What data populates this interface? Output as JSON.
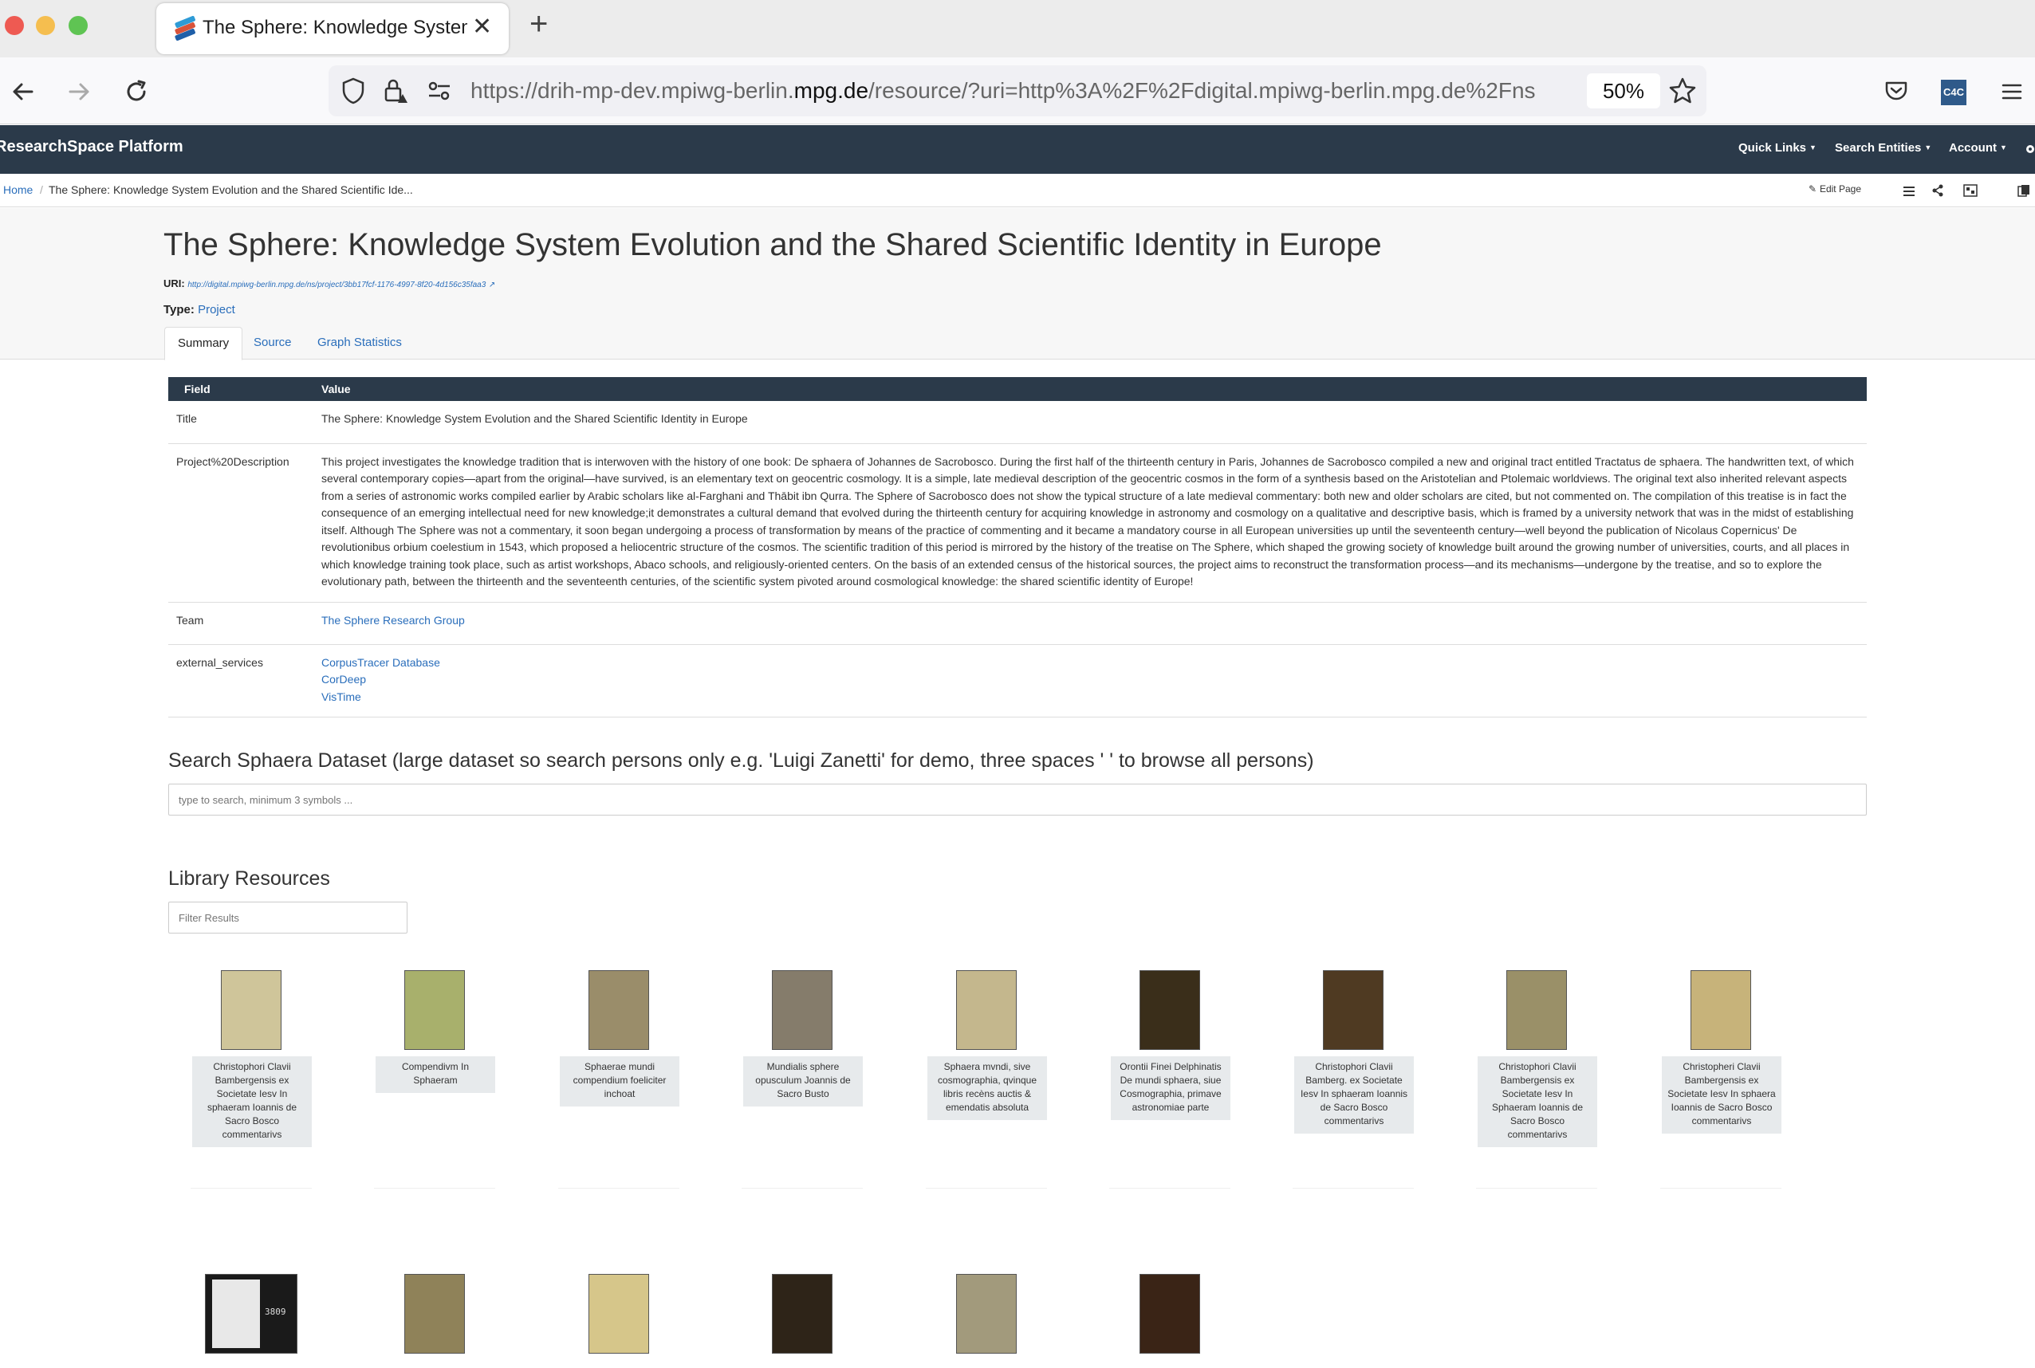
{
  "browser": {
    "tab_title": "The Sphere: Knowledge System Evolution and the Shared Scientific Identity in Europe",
    "new_tab": "+",
    "close": "✕",
    "url_prefix": "https://drih-mp-dev.mpiwg-berlin.",
    "url_domain": "mpg.de",
    "url_suffix": "/resource/?uri=http%3A%2F%2Fdigital.mpiwg-berlin.mpg.de%2Fns",
    "zoom": "50%",
    "extension_label": "C4C"
  },
  "app": {
    "brand": "ResearchSpace Platform",
    "nav": [
      "Quick Links",
      "Search Entities",
      "Account"
    ]
  },
  "breadcrumb": {
    "home": "Home",
    "separator": "/",
    "current": "The Sphere: Knowledge System Evolution and the Shared Scientific Ide..."
  },
  "toolbar": {
    "edit_page": "Edit Page"
  },
  "header": {
    "title": "The Sphere: Knowledge System Evolution and the Shared Scientific Identity in Europe",
    "uri_label": "URI:",
    "uri": "http://digital.mpiwg-berlin.mpg.de/ns/project/3bb17fcf-1176-4997-8f20-4d156c35faa3",
    "type_label": "Type:",
    "type": "Project",
    "tabs": [
      "Summary",
      "Source",
      "Graph Statistics"
    ]
  },
  "table": {
    "headers": [
      "Field",
      "Value"
    ],
    "rows": {
      "title": {
        "field": "Title",
        "value": "The Sphere: Knowledge System Evolution and the Shared Scientific Identity in Europe"
      },
      "description": {
        "field": "Project%20Description",
        "value": "This project investigates the knowledge tradition that is interwoven with the history of one book: De sphaera of Johannes de Sacrobosco. During the first half of the thirteenth century in Paris, Johannes de Sacrobosco compiled a new and original tract entitled Tractatus de sphaera. The handwritten text, of which several contemporary copies—apart from the original—have survived, is an elementary text on geocentric cosmology. It is a simple, late medieval description of the geocentric cosmos in the form of a synthesis based on the Aristotelian and Ptolemaic worldviews. The original text also inherited relevant aspects from a series of astronomic works compiled earlier by Arabic scholars like al-Farghani and Thābit ibn Qurra. The Sphere of Sacrobosco does not show the typical structure of a late medieval commentary: both new and older scholars are cited, but not commented on. The compilation of this treatise is in fact the consequence of an emerging intellectual need for new knowledge;it demonstrates a cultural demand that evolved during the thirteenth century for acquiring knowledge in astronomy and cosmology on a qualitative and descriptive basis, which is framed by a university network that was in the midst of establishing itself. Although The Sphere was not a commentary, it soon began undergoing a process of transformation by means of the practice of commenting and it became a mandatory course in all European universities up until the seventeenth century—well beyond the publication of Nicolaus Copernicus' De revolutionibus orbium coelestium in 1543, which proposed a heliocentric structure of the cosmos. The scientific tradition of this period is mirrored by the history of the treatise on The Sphere, which shaped the growing society of knowledge built around the growing number of universities, courts, and all places in which knowledge training took place, such as artist workshops, Abaco schools, and religiously-oriented centers. On the basis of an extended census of the historical sources, the project aims to reconstruct the transformation process—and its mechanisms—undergone by the treatise, and so to explore the evolutionary path, between the thirteenth and the seventeenth centuries, of the scientific system pivoted around cosmological knowledge: the shared scientific identity of Europe!"
      },
      "team": {
        "field": "Team",
        "value": "The Sphere Research Group"
      },
      "external_services": {
        "field": "external_services",
        "values": [
          "CorpusTracer Database",
          "CorDeep",
          "VisTime"
        ]
      }
    }
  },
  "search": {
    "heading": "Search Sphaera Dataset (large dataset so search persons only e.g. 'Luigi Zanetti' for demo, three spaces '   ' to browse all persons)",
    "placeholder": "type to search, minimum 3 symbols ..."
  },
  "library": {
    "heading": "Library Resources",
    "filter_placeholder": "Filter Results",
    "cards": [
      {
        "caption": "Christophori Clavii Bambergensis ex Societate Iesv In sphaeram Ioannis de Sacro Bosco commentarivs",
        "color": "#cfc59a"
      },
      {
        "caption": "Compendivm In Sphaeram",
        "color": "#a8b06c"
      },
      {
        "caption": "Sphaerae mundi compendium foeliciter inchoat",
        "color": "#9a8d6a"
      },
      {
        "caption": "Mundialis sphere opusculum Joannis de Sacro Busto",
        "color": "#857c6b"
      },
      {
        "caption": "Sphaera mvndi, sive cosmographia, qvinque libris recèns auctis & emendatis absoluta",
        "color": "#c4b78d"
      },
      {
        "caption": "Orontii Finei Delphinatis De mundi sphaera, siue Cosmographia, primave astronomiae parte",
        "color": "#3a2e1a"
      },
      {
        "caption": "Christophori Clavii Bamberg. ex Societate Iesv In sphaeram Ioannis de Sacro Bosco commentarivs",
        "color": "#4f3a22"
      },
      {
        "caption": "Christophori Clavii Bambergensis ex Societate Iesv In Sphaeram Ioannis de Sacro Bosco commentarivs",
        "color": "#9a9068"
      },
      {
        "caption": "Christopheri Clavii Bambergensis ex Societate Iesv In sphaera Ioannis de Sacro Bosco commentarivs",
        "color": "#c7b37a"
      }
    ],
    "cards_row2": [
      {
        "color": "#1a1a1a",
        "doc_number": "3809"
      },
      {
        "color": "#8f8259"
      },
      {
        "color": "#d6c68a"
      },
      {
        "color": "#2e2418"
      },
      {
        "color": "#a29a7c"
      },
      {
        "color": "#3a2416"
      }
    ]
  },
  "colors": {
    "navbar": "#2b3a4a",
    "link": "#2a6ebb"
  }
}
